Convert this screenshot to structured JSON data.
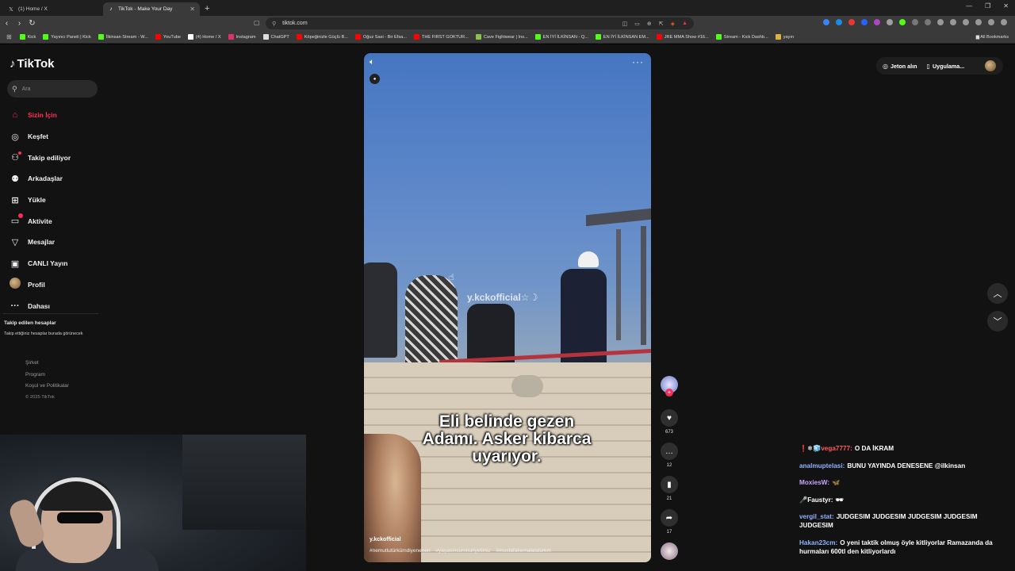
{
  "browser": {
    "tabs": [
      {
        "title": "(1) Home / X",
        "icon": "x-logo-icon",
        "active": false
      },
      {
        "title": "TikTok - Make Your Day",
        "icon": "tiktok-logo-icon",
        "active": true
      }
    ],
    "url": "tiktok.com",
    "bookmarks": [
      {
        "label": "Kick",
        "color": "#53fc18"
      },
      {
        "label": "Yayıncı Paneli | Kick",
        "color": "#53fc18"
      },
      {
        "label": "İlkinsan Stream - W...",
        "color": "#53fc18"
      },
      {
        "label": "YouTube",
        "color": "#ff0000"
      },
      {
        "label": "(4) Home / X",
        "color": "#ffffff"
      },
      {
        "label": "Instagram",
        "color": "#e1306c"
      },
      {
        "label": "ChatGPT",
        "color": "#dddddd"
      },
      {
        "label": "Köpeğinizle Güçlü B...",
        "color": "#ff0000"
      },
      {
        "label": "Oğuz Sasi - Bir Efsa...",
        "color": "#ff0000"
      },
      {
        "label": "THE FIRST GOKTUR...",
        "color": "#ff0000"
      },
      {
        "label": "Cave Fightwear | Ins...",
        "color": "#8bc34a"
      },
      {
        "label": "EN İYİ İLKİNSAN - Q...",
        "color": "#53fc18"
      },
      {
        "label": "EN İYİ İLKİNSAN EM...",
        "color": "#53fc18"
      },
      {
        "label": "JRE MMA Show #16...",
        "color": "#ff0000"
      },
      {
        "label": "Stream - Kick Dashb...",
        "color": "#53fc18"
      },
      {
        "label": "yayın",
        "color": "#e0b040"
      }
    ],
    "all_bookmarks": "All Bookmarks"
  },
  "sidebar": {
    "logo": "TikTok",
    "search_placeholder": "Ara",
    "items": [
      {
        "label": "Sizin İçin",
        "icon": "home-icon",
        "active": true
      },
      {
        "label": "Keşfet",
        "icon": "compass-icon",
        "active": false
      },
      {
        "label": "Takip ediliyor",
        "icon": "following-icon",
        "active": false
      },
      {
        "label": "Arkadaşlar",
        "icon": "friends-icon",
        "active": false
      },
      {
        "label": "Yükle",
        "icon": "upload-icon",
        "active": false
      },
      {
        "label": "Aktivite",
        "icon": "activity-icon",
        "active": false
      },
      {
        "label": "Mesajlar",
        "icon": "messages-icon",
        "active": false
      },
      {
        "label": "CANLI Yayın",
        "icon": "live-icon",
        "active": false
      },
      {
        "label": "Profil",
        "icon": "avatar-icon",
        "active": false
      },
      {
        "label": "Dahası",
        "icon": "more-icon",
        "active": false
      }
    ],
    "following_title": "Takip edilen hesaplar",
    "following_sub": "Takip ettiğiniz hesaplar burada görünecek",
    "footer": [
      "Şirket",
      "Program",
      "Koşul ve Politikalar"
    ],
    "copyright": "© 2025 TikTok"
  },
  "video": {
    "watermark": "y.kckofficial☆☽",
    "caption_line1": "Eli belinde gezen",
    "caption_line2": "Adamı. Asker kibarca",
    "caption_line3": "uyarıyor.",
    "author": "y.kckofficial",
    "hashtags": [
      "#nemutlutürkümdiyenenen",
      "#yaşasıncumhuriyetimiz",
      "#mustafakemalatatürkm"
    ]
  },
  "actions": {
    "likes": "673",
    "comments": "12",
    "saves": "21",
    "shares": "17"
  },
  "topbar": {
    "coins": "Jeton alın",
    "app": "Uygulama..."
  },
  "chat": [
    {
      "user": "vega7777:",
      "user_color": "#ff5a5a",
      "badges": "❗❄🧊",
      "text": "O DA İKRAM"
    },
    {
      "user": "analmuptelasi:",
      "user_color": "#8fb3ff",
      "badges": "",
      "text": "BUNU YAYINDA DENESENE @ilkinsan"
    },
    {
      "user": "MoxiesW:",
      "user_color": "#c9a5ff",
      "badges": "",
      "text": "🦋"
    },
    {
      "user": "Faustyr:",
      "user_color": "#ffffff",
      "badges": "🎤",
      "text": "🕶"
    },
    {
      "user": "vergil_stat:",
      "user_color": "#8fb3ff",
      "badges": "",
      "text": "JUDGESIM JUDGESIM JUDGESIM JUDGESIM JUDGESIM"
    },
    {
      "user": "Hakan23cm:",
      "user_color": "#8fb3ff",
      "badges": "",
      "text": "O yeni taktik olmuş öyle kitliyorlar Ramazanda da hurmaları 600tl den kitliyorlardı"
    }
  ]
}
